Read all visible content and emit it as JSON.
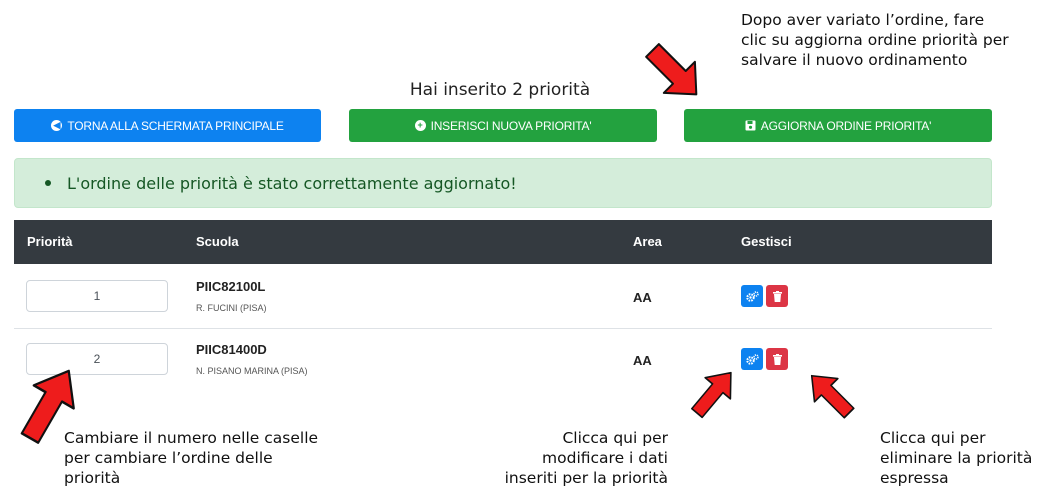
{
  "heading": "Hai inserito 2 priorità",
  "buttons": {
    "back": "TORNA ALLA SCHERMATA PRINCIPALE",
    "insert": "INSERISCI NUOVA PRIORITA'",
    "update": "AGGIORNA ORDINE PRIORITA'"
  },
  "alert": "L'ordine delle priorità è stato correttamente aggiornato!",
  "table": {
    "headers": [
      "Priorità",
      "Scuola",
      "Area",
      "Gestisci"
    ],
    "rows": [
      {
        "priority": "1",
        "code": "PIIC82100L",
        "school": "R. FUCINI (PISA)",
        "area": "AA"
      },
      {
        "priority": "2",
        "code": "PIIC81400D",
        "school": "N. PISANO MARINA (PISA)",
        "area": "AA"
      }
    ]
  },
  "annotations": {
    "top_right": [
      "Dopo aver variato l’ordine, fare",
      "clic su aggiorna ordine priorità per",
      "salvare il nuovo ordinamento"
    ],
    "bottom_left": [
      "Cambiare il numero nelle caselle",
      "per cambiare l’ordine delle",
      "priorità"
    ],
    "bottom_mid": [
      "Clicca qui per",
      "modificare i dati",
      "inseriti per la priorità"
    ],
    "bottom_right": [
      "Clicca qui per",
      "eliminare la priorità",
      "espressa"
    ]
  },
  "colors": {
    "primary": "#0d82f0",
    "success": "#23a23f",
    "danger": "#dc3545",
    "dark": "#343a40",
    "arrow": "#ee1c1c"
  },
  "icons": [
    "arrow-left-circle-icon",
    "plus-circle-icon",
    "save-icon",
    "cogs-icon",
    "trash-icon",
    "red-arrow-icon"
  ]
}
